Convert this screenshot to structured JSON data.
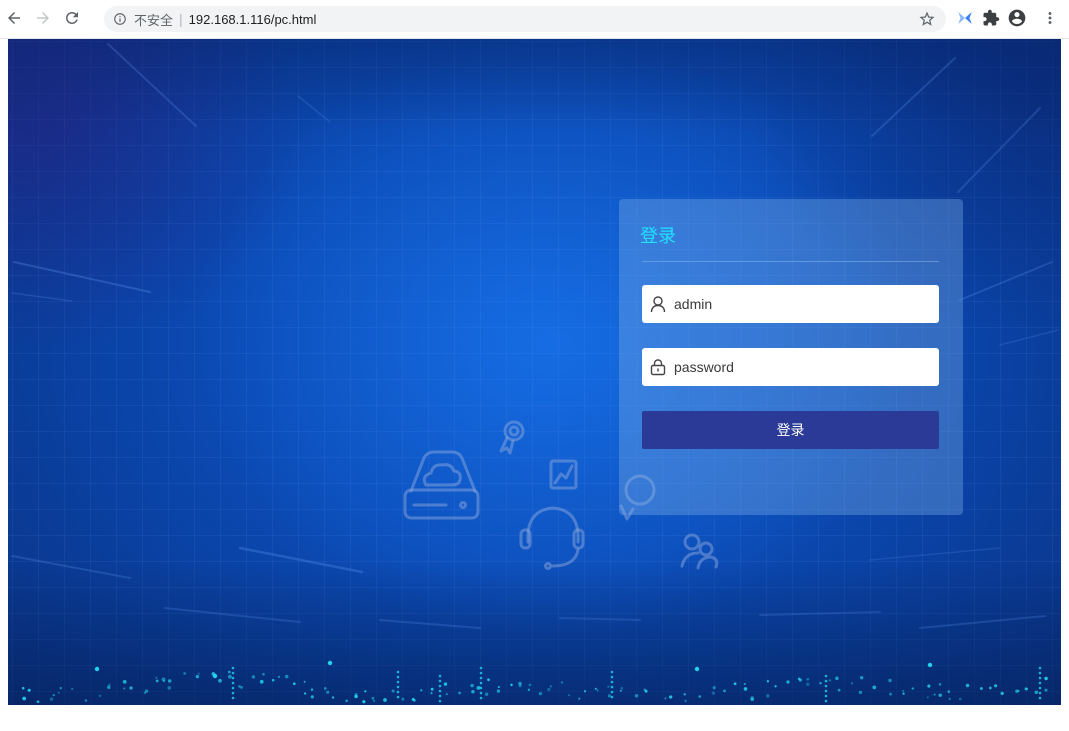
{
  "browser": {
    "icons": {
      "back": "arrow-left-icon",
      "forward": "arrow-right-icon",
      "reload": "reload-icon",
      "site_info": "info-icon",
      "bookmark": "star-icon",
      "extension": "extension-arrows-icon",
      "extensions_menu": "puzzle-icon",
      "profile": "account-circle-icon",
      "menu": "more-vert-icon"
    },
    "security_label": "不安全",
    "separator": "|",
    "url": "192.168.1.116/pc.html"
  },
  "login": {
    "title": "登录",
    "username": {
      "icon": "user-icon",
      "placeholder": "admin"
    },
    "password": {
      "icon": "lock-icon",
      "placeholder": "password"
    },
    "submit_label": "登录"
  },
  "background": {
    "icons": [
      "cloud-drive-icon",
      "medal-icon",
      "chart-icon",
      "headset-icon",
      "people-icon"
    ]
  },
  "colors": {
    "title": "#22e1ff",
    "button": "#2b3a96",
    "dots": "#22d3ee"
  }
}
